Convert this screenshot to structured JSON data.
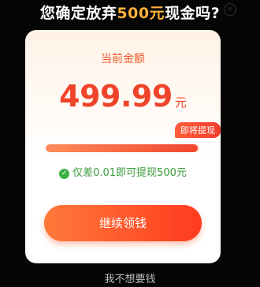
{
  "dialog": {
    "headline_prefix": "您确定放弃",
    "headline_highlight": "500元",
    "headline_suffix": "现金吗?",
    "card_label": "当前金额",
    "amount": "499.99",
    "amount_unit": "元",
    "badge": "即将提现",
    "progress_fraction": 0.985,
    "hint": "仅差0.01即可提现500元",
    "continue_button": "继续领钱",
    "decline_link": "我不想要钱"
  },
  "colors": {
    "accent": "#f0442a",
    "highlight": "#ffb23a",
    "hint_green": "#3a9a3a"
  },
  "icons": {
    "close": "close-icon",
    "check": "check-circle-icon"
  }
}
